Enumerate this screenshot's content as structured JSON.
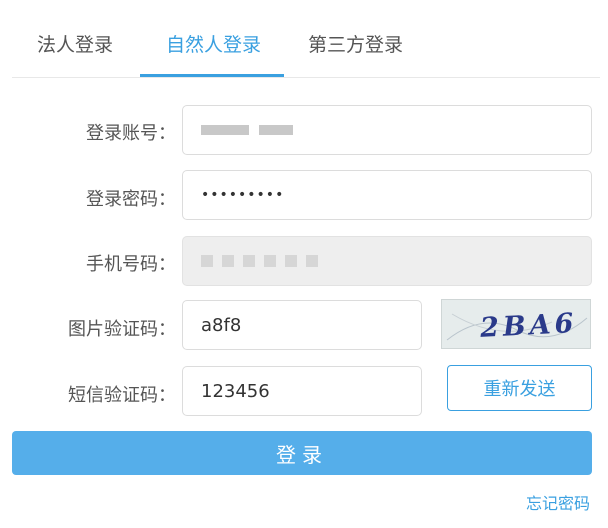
{
  "tabs": [
    {
      "label": "法人登录",
      "active": false
    },
    {
      "label": "自然人登录",
      "active": true
    },
    {
      "label": "第三方登录",
      "active": false
    }
  ],
  "form": {
    "account_label": "登录账号：",
    "password_label": "登录密码：",
    "password_value": "•••••••••",
    "phone_label": "手机号码：",
    "captcha_label": "图片验证码：",
    "captcha_value": "a8f8",
    "captcha_image_text": "2BA6",
    "sms_label": "短信验证码：",
    "sms_value": "123456",
    "resend_label": "重新发送"
  },
  "login_label": "登录",
  "forgot_label": "忘记密码",
  "colors": {
    "accent": "#3aa0e0",
    "login_button": "#55aeea",
    "disabled_field": "#eeeeee"
  }
}
